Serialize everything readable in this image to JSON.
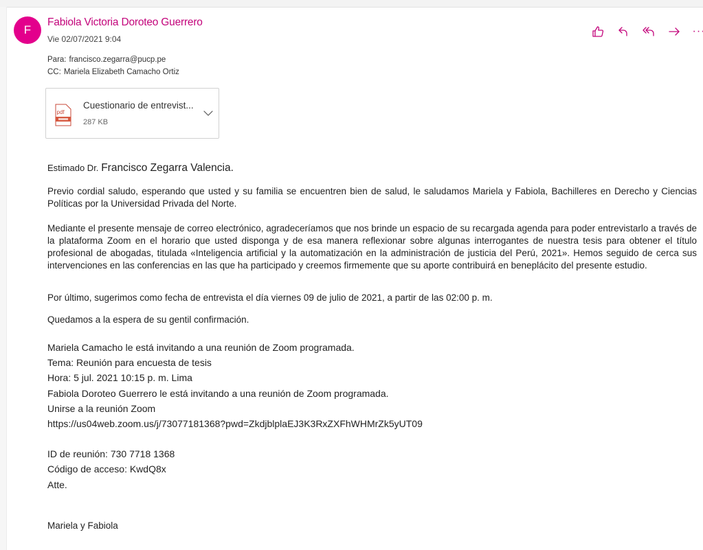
{
  "message": {
    "avatar_initial": "F",
    "sender_name": "Fabiola Victoria Doroteo Guerrero",
    "date": "Vie 02/07/2021 9:04",
    "to_label": "Para:",
    "to_value": "francisco.zegarra@pucp.pe",
    "cc_label": "CC:",
    "cc_value": "Mariela Elizabeth Camacho Ortiz",
    "accent_color": "#c3047b",
    "avatar_color": "#e3008c"
  },
  "actions": {
    "like_icon": "thumbs-up-icon",
    "reply_icon": "reply-icon",
    "reply_all_icon": "reply-all-icon",
    "forward_icon": "forward-icon",
    "more_label": "···"
  },
  "attachment": {
    "icon": "pdf-file-icon",
    "icon_label": "pdf",
    "name": "Cuestionario de entrevist...",
    "size": "287 KB"
  },
  "body": {
    "greeting_prefix": "Estimado Dr.",
    "greeting_name": "Francisco Zegarra Valencia.",
    "p1": "Previo cordial saludo, esperando que usted y su familia se encuentren bien de salud, le saludamos Mariela y Fabiola, Bachilleres en Derecho y Ciencias Políticas por la Universidad Privada del Norte.",
    "p2": "Mediante el presente mensaje de correo electrónico, agradeceríamos que nos brinde un espacio de su recargada agenda para poder entrevistarlo a través de la plataforma Zoom en el horario que usted disponga y de esa manera reflexionar sobre algunas interrogantes de nuestra tesis para obtener el título profesional de abogadas, titulada «Inteligencia artificial y la automatización en la administración de justicia del Perú, 2021». Hemos seguido de cerca sus intervenciones en las conferencias en las que ha participado y creemos firmemente que su aporte contribuirá en beneplácito del presente estudio.",
    "p3": "Por último, sugerimos como fecha de entrevista el día viernes 09 de julio de 2021, a partir de las 02:00 p. m.",
    "p4": "Quedamos a la espera de su gentil confirmación."
  },
  "zoom": {
    "line1": "Mariela Camacho le está invitando a una reunión de Zoom programada.",
    "line2": "Tema: Reunión para encuesta de tesis",
    "line3": "Hora: 5 jul. 2021 10:15 p. m. Lima",
    "line4": "Fabiola Doroteo Guerrero le está invitando a una reunión de Zoom programada.",
    "line5": "Unirse a la reunión Zoom",
    "link": "https://us04web.zoom.us/j/73077181368?pwd=ZkdjblplaEJ3K3RxZXFhWHMrZk5yUT09",
    "meeting_id": "ID de reunión: 730 7718 1368",
    "access_code": "Código de acceso: KwdQ8x",
    "closing": "Atte."
  },
  "signature": "Mariela y Fabiola"
}
